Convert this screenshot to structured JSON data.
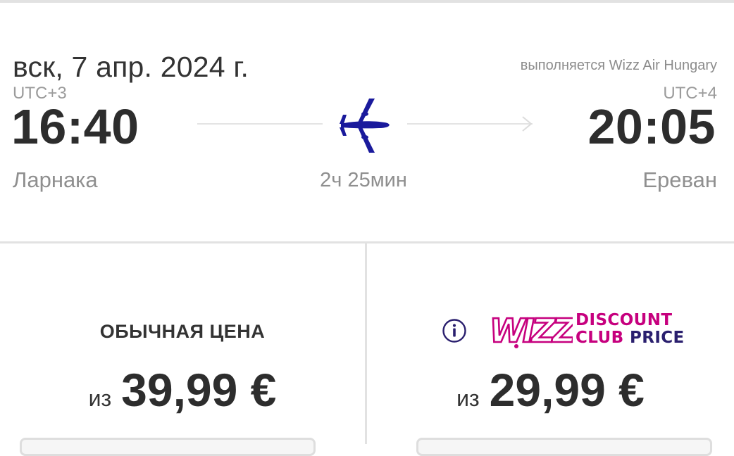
{
  "flight": {
    "date": "вск, 7 апр. 2024 г.",
    "operator": "выполняется Wizz Air Hungary",
    "departure": {
      "timezone": "UTC+3",
      "time": "16:40",
      "city": "Ларнака"
    },
    "arrival": {
      "timezone": "UTC+4",
      "time": "20:05",
      "city": "Ереван"
    },
    "duration": "2ч 25мин",
    "icons": {
      "plane": "airplane-icon",
      "arrow": "arrow-right-icon"
    },
    "plane_color": "#1a1a9c"
  },
  "fares": {
    "regular": {
      "label": "ОБЫЧНАЯ ЦЕНА",
      "prefix": "из",
      "price": "39,99 €"
    },
    "club": {
      "logo_text": "WIZZ",
      "club_line1": "DISCOUNT",
      "club_line2_a": "CLUB",
      "club_line2_b": "PRICE",
      "prefix": "из",
      "price": "29,99 €",
      "icons": {
        "info": "info-icon",
        "logo": "wizz-logo"
      },
      "brand_color": "#c6007e",
      "brand_dark": "#2a1f6e"
    }
  }
}
